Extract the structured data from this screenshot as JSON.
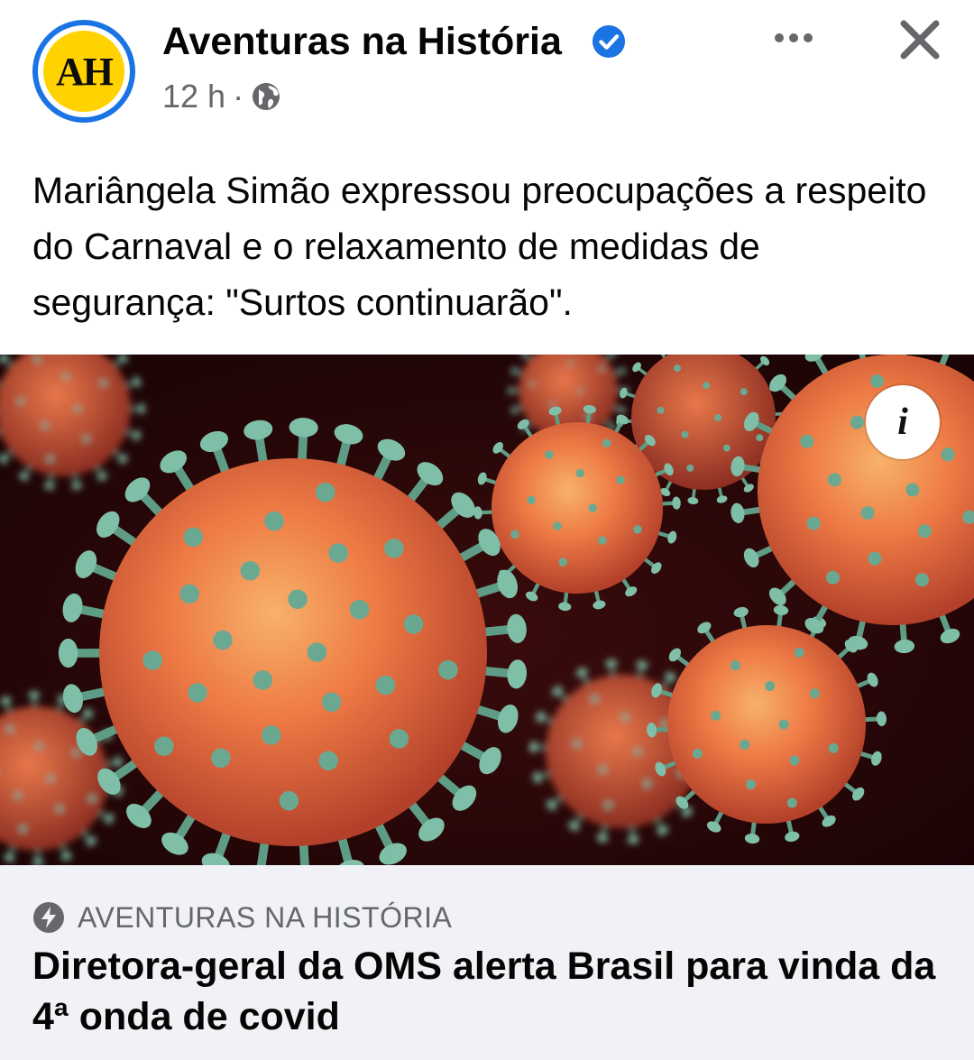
{
  "post": {
    "avatar_initials": "AH",
    "page_name": "Aventuras na História",
    "time": "12 h",
    "separator": "·",
    "text": "Mariângela Simão expressou preocupações a respeito do Carnaval e o relaxamento de medidas de segurança: \"Surtos continuarão\"."
  },
  "media": {
    "info_label": "i"
  },
  "link_card": {
    "source": "AVENTURAS NA HISTÓRIA",
    "headline": "Diretora-geral da OMS alerta Brasil para vinda da 4ª onda de covid"
  },
  "icons": {
    "verified": "verified-badge-icon",
    "privacy": "globe-icon",
    "more": "more-options-icon",
    "close": "close-icon",
    "source": "bolt-icon"
  },
  "colors": {
    "accent": "#1b74e4",
    "logo_yellow": "#ffd200",
    "secondary_text": "#65676b",
    "card_background": "#f0f2f5"
  }
}
